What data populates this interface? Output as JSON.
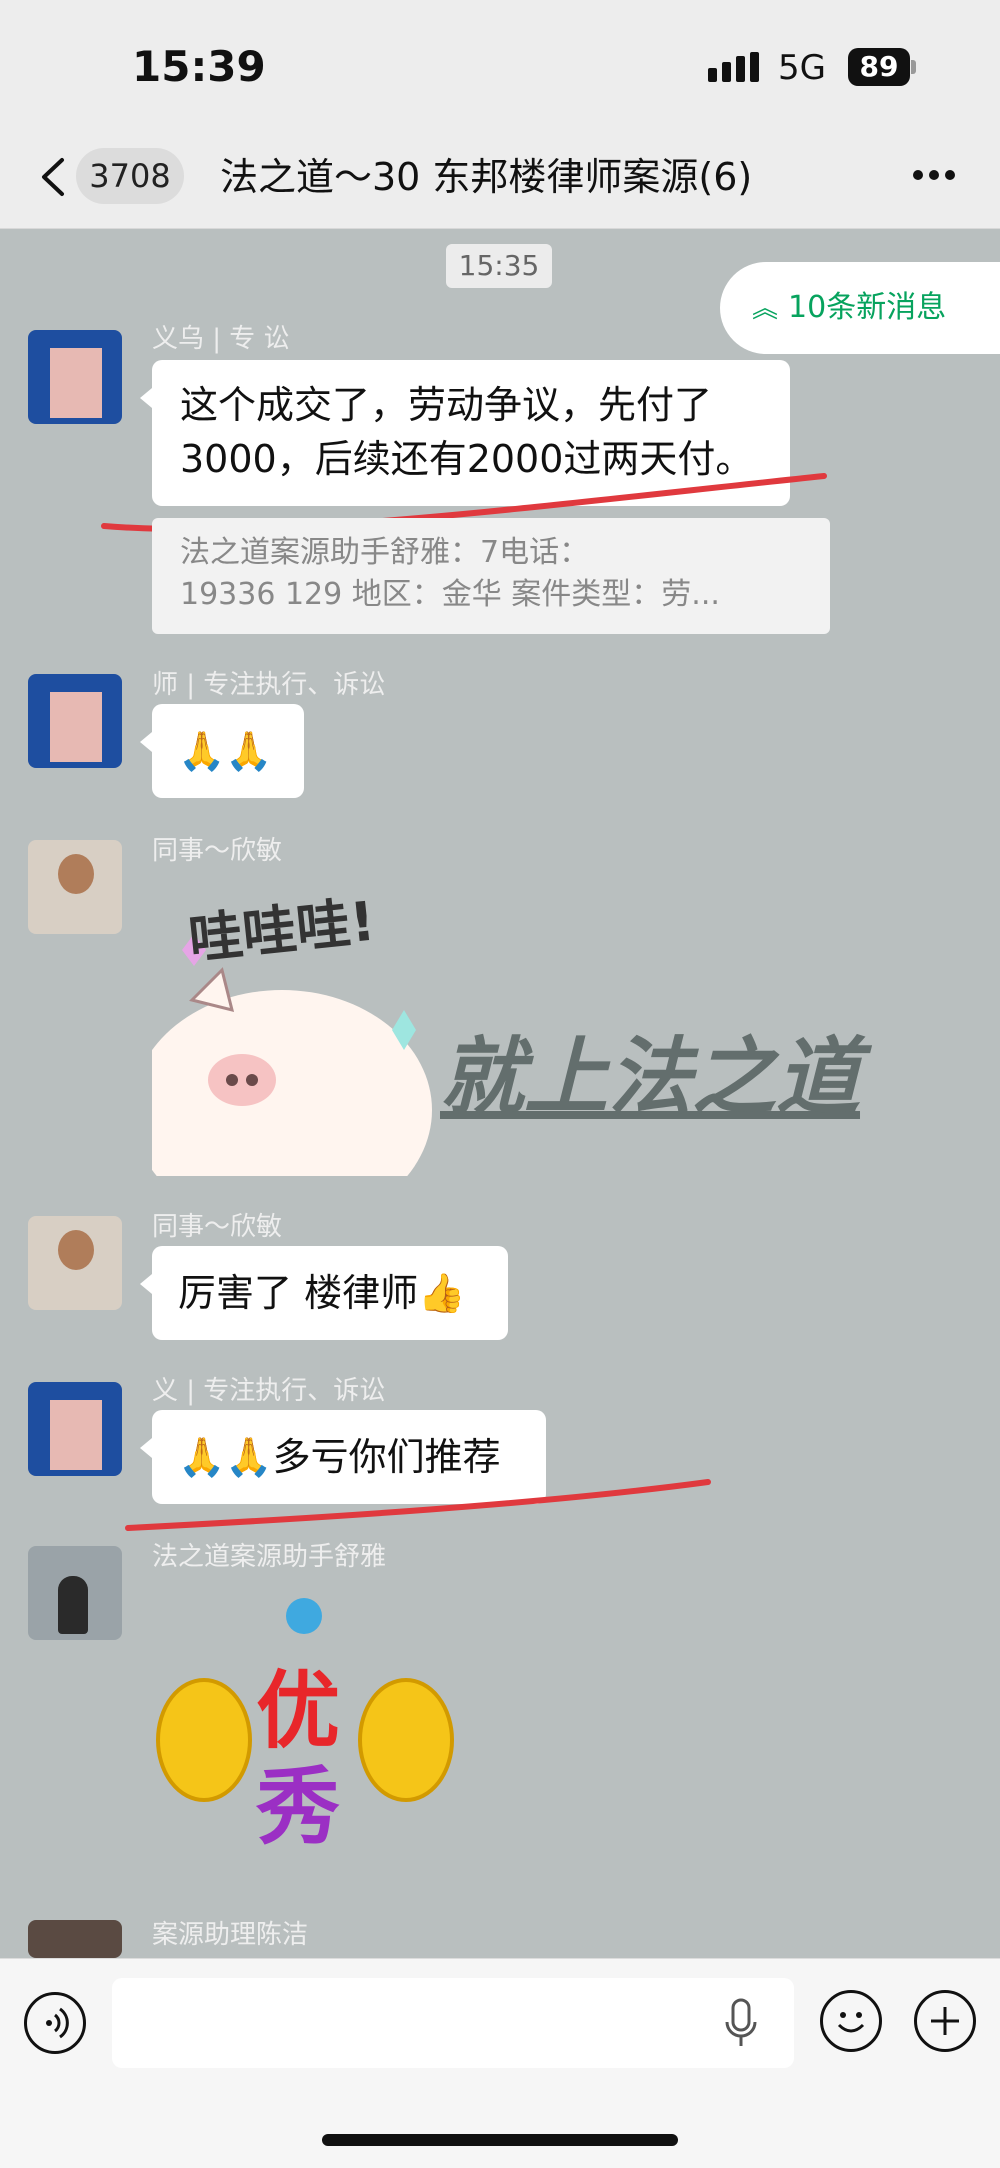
{
  "status": {
    "time": "15:39",
    "network": "5G",
    "battery": "89"
  },
  "header": {
    "unread_count": "3708",
    "title": "法之道～30 东邦楼律师案源(6)"
  },
  "chat": {
    "time_separator": "15:35",
    "new_messages_label": "10条新消息",
    "messages": [
      {
        "sender": "义乌 | 专 讼",
        "text_line1": "这个成交了，劳动争议，先付了",
        "text_line2": "3000，后续还有2000过两天付。",
        "quote_line1": "法之道案源助手舒雅：7电话：",
        "quote_line2": "19336 129 地区：金华 案件类型：劳..."
      },
      {
        "sender": "师 | 专注执行、诉讼",
        "text": "🙏🙏"
      },
      {
        "sender": "同事～欣敏",
        "sticker_text": "哇哇哇!",
        "watermark": "就上法之道"
      },
      {
        "sender": "同事～欣敏",
        "text": "厉害了 楼律师👍"
      },
      {
        "sender": "义 | 专注执行、诉讼",
        "text": "🙏🙏多亏你们推荐"
      },
      {
        "sender": "法之道案源助手舒雅",
        "sticker_text_1": "优",
        "sticker_text_2": "秀"
      },
      {
        "sender": "案源助理陈洁"
      }
    ]
  },
  "colors": {
    "chat_bg": "#b9bfbf",
    "accent": "#07a35e",
    "annotation_red": "#e0393e"
  },
  "icons": [
    "back-icon",
    "more-icon",
    "voice-icon",
    "microphone-icon",
    "emoji-icon",
    "plus-icon"
  ]
}
